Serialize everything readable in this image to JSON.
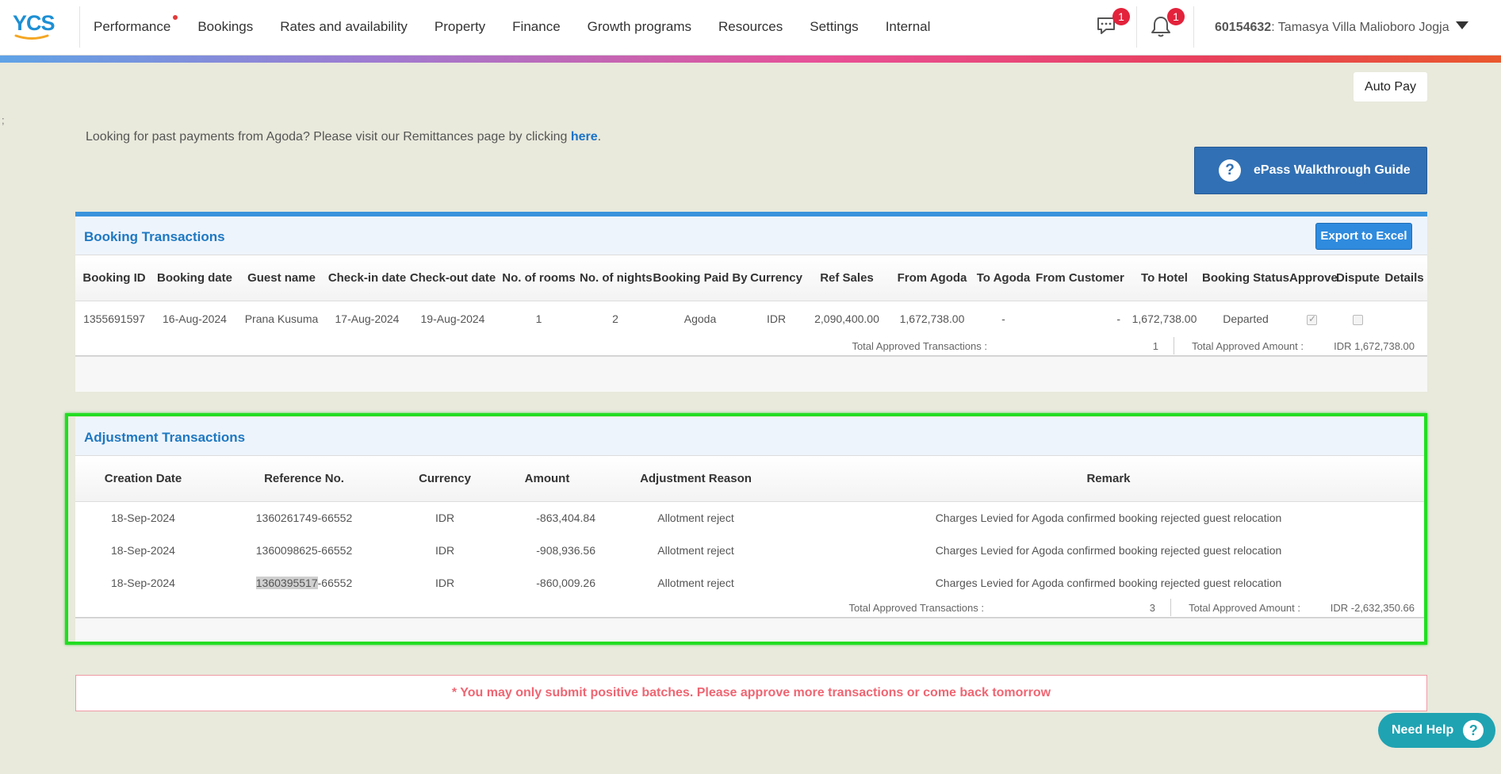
{
  "header": {
    "logo": "YCS",
    "nav": [
      {
        "label": "Performance",
        "dot": true
      },
      {
        "label": "Bookings"
      },
      {
        "label": "Rates and availability"
      },
      {
        "label": "Property"
      },
      {
        "label": "Finance"
      },
      {
        "label": "Growth programs"
      },
      {
        "label": "Resources"
      },
      {
        "label": "Settings"
      },
      {
        "label": "Internal"
      }
    ],
    "messages_badge": "1",
    "notifications_badge": "1",
    "property_id": "60154632",
    "property_name": ": Tamasya Villa Malioboro Jogja"
  },
  "stray_text": ";",
  "auto_pay_label": "Auto Pay",
  "remittance_notice": {
    "text": "Looking for past payments from Agoda? Please visit our Remittances page by clicking ",
    "link": "here",
    "suffix": "."
  },
  "epass_label": "ePass Walkthrough Guide",
  "booking_transactions": {
    "title": "Booking Transactions",
    "export_label": "Export to Excel",
    "columns": [
      "Booking ID",
      "Booking date",
      "Guest name",
      "Check-in date",
      "Check-out date",
      "No. of rooms",
      "No. of nights",
      "Booking Paid By",
      "Currency",
      "Ref Sales",
      "From Agoda",
      "To Agoda",
      "From Customer",
      "To Hotel",
      "Booking Status",
      "Approve",
      "Dispute",
      "Details"
    ],
    "rows": [
      [
        "1355691597",
        "16-Aug-2024",
        "Prana Kusuma",
        "17-Aug-2024",
        "19-Aug-2024",
        "1",
        "2",
        "Agoda",
        "IDR",
        "2,090,400.00",
        "1,672,738.00",
        "-",
        "-",
        "1,672,738.00",
        "Departed"
      ]
    ],
    "totals": {
      "count_label": "Total Approved Transactions :",
      "count": "1",
      "amount_label": "Total Approved Amount :",
      "amount": "IDR 1,672,738.00"
    }
  },
  "adjustment_transactions": {
    "title": "Adjustment Transactions",
    "columns": [
      "Creation Date",
      "Reference No.",
      "Currency",
      "Amount",
      "Adjustment Reason",
      "Remark"
    ],
    "rows": [
      {
        "date": "18-Sep-2024",
        "ref_main": "1360261749",
        "ref_suffix": "-66552",
        "currency": "IDR",
        "amount": "-863,404.84",
        "reason": "Allotment reject",
        "remark": "Charges Levied for Agoda confirmed booking rejected guest relocation"
      },
      {
        "date": "18-Sep-2024",
        "ref_main": "1360098625",
        "ref_suffix": "-66552",
        "currency": "IDR",
        "amount": "-908,936.56",
        "reason": "Allotment reject",
        "remark": "Charges Levied for Agoda confirmed booking rejected guest relocation"
      },
      {
        "date": "18-Sep-2024",
        "ref_main": "1360395517",
        "ref_suffix": "-66552",
        "currency": "IDR",
        "amount": "-860,009.26",
        "reason": "Allotment reject",
        "remark": "Charges Levied for Agoda confirmed booking rejected guest relocation"
      }
    ],
    "totals": {
      "count_label": "Total Approved Transactions :",
      "count": "3",
      "amount_label": "Total Approved Amount :",
      "amount": "IDR -2,632,350.66"
    }
  },
  "warning": "* You may only submit positive batches. Please approve more transactions or come back tomorrow",
  "need_help_label": "Need Help",
  "colors": {
    "accent": "#1e78c2",
    "highlight_box": "#22dd22",
    "warning_text": "#ef6572",
    "help_button": "#1fa3b2"
  }
}
